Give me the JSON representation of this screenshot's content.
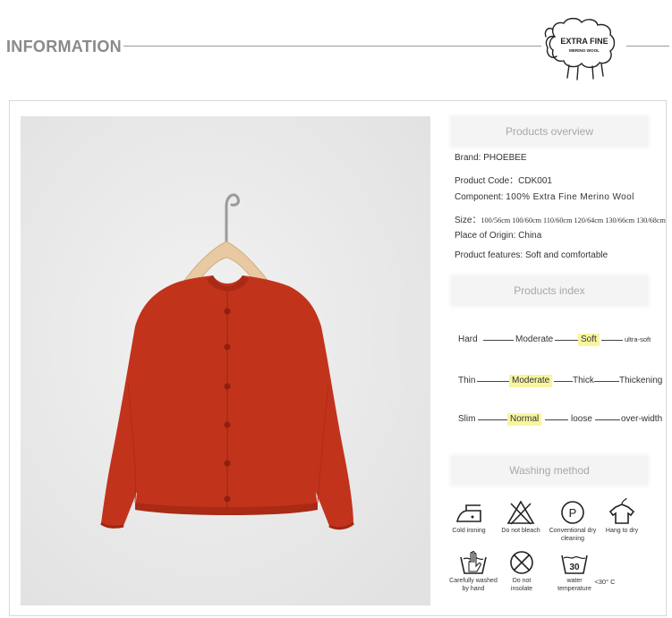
{
  "header": {
    "title": "INFORMATION"
  },
  "logo": {
    "line1": "EXTRA FINE",
    "line2": "MERINO WOOL"
  },
  "overview": {
    "heading": "Products overview",
    "rows": [
      {
        "key": "Brand:",
        "value": "PHOEBEE"
      },
      {
        "key": "Product Code：",
        "value": "CDK001"
      },
      {
        "key": "Component:",
        "value": "100% Extra Fine Merino Wool"
      },
      {
        "key": "Size：",
        "value": "100/56cm 100/60cm 110/60cm 120/64cm 130/66cm 130/68cm"
      },
      {
        "key": "Place of Origin:",
        "value": "China"
      },
      {
        "key": "Product features:",
        "value": "Soft and comfortable"
      }
    ]
  },
  "index": {
    "heading": "Products index",
    "rows": [
      {
        "labels": [
          "Hard",
          "Moderate",
          "Soft",
          "ultra-soft"
        ],
        "highlight": 2
      },
      {
        "labels": [
          "Thin",
          "Moderate",
          "Thick",
          "Thickening"
        ],
        "highlight": 1
      },
      {
        "labels": [
          "Slim",
          "Normal",
          "loose",
          "over-width"
        ],
        "highlight": 1
      }
    ]
  },
  "washing": {
    "heading": "Washing method",
    "items": [
      {
        "icon": "iron-icon",
        "label": "Cold ironing"
      },
      {
        "icon": "no-bleach-icon",
        "label": "Do not bleach"
      },
      {
        "icon": "dry-clean-icon",
        "label": "Conventional dry cleaning",
        "letter": "P"
      },
      {
        "icon": "hang-dry-icon",
        "label": "Hang to dry"
      },
      {
        "icon": "hand-wash-icon",
        "label": "Carefully washed by hand"
      },
      {
        "icon": "no-insolate-icon",
        "label": "Do not insolate"
      },
      {
        "icon": "water-temp-icon",
        "label": "water temperature",
        "number": "30",
        "extra": "<30° C"
      }
    ]
  },
  "colors": {
    "garment": "#c2331b",
    "highlight": "#f8f5a0",
    "heading_text": "#a8a8a8"
  }
}
